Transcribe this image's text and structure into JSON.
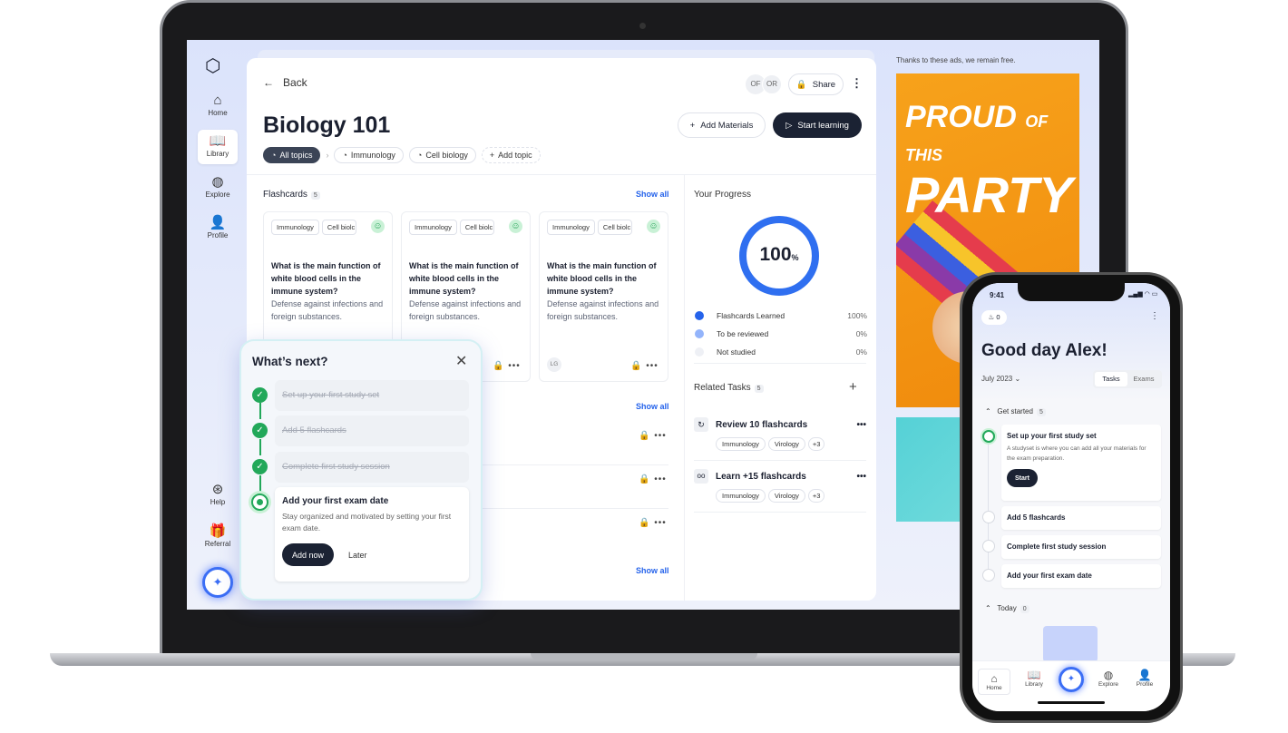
{
  "sidebar": {
    "items": [
      {
        "label": "Home",
        "icon": "home-icon"
      },
      {
        "label": "Library",
        "icon": "book-icon"
      },
      {
        "label": "Explore",
        "icon": "globe-icon"
      },
      {
        "label": "Profile",
        "icon": "user-icon"
      },
      {
        "label": "Help",
        "icon": "lifebuoy-icon"
      },
      {
        "label": "Referral",
        "icon": "gift-hand-icon"
      }
    ],
    "active": "Library"
  },
  "header": {
    "back": "Back",
    "avatars": [
      "OF",
      "OR"
    ],
    "share": "Share",
    "title": "Biology 101",
    "add_materials": "Add Materials",
    "start_learning": "Start learning"
  },
  "topics": [
    "All topics",
    "Immunology",
    "Cell biology",
    "Add topic"
  ],
  "flashcards": {
    "title": "Flashcards",
    "count": "5",
    "show_all": "Show all",
    "cards": [
      {
        "tags": [
          "Immunology",
          "Cell biolc"
        ],
        "question": "What is the main function of white blood cells in the immune system?",
        "answer": "Defense against infections and foreign substances."
      },
      {
        "tags": [
          "Immunology",
          "Cell biolc"
        ],
        "question": "What is the main function of white blood cells in the immune system?",
        "answer": "Defense against infections and foreign substances."
      },
      {
        "tags": [
          "Immunology",
          "Cell biolc"
        ],
        "question": "What is the main function of white blood cells in the immune system?",
        "answer": "Defense against infections and foreign substances.",
        "avatar": "LG"
      }
    ]
  },
  "section2": {
    "show_all": "Show all"
  },
  "section3": {
    "show_all": "Show all"
  },
  "progress": {
    "title": "Your Progress",
    "value": "100",
    "unit": "%",
    "percent": 100,
    "legend": [
      {
        "label": "Flashcards Learned",
        "value": "100%",
        "color": "#2563eb"
      },
      {
        "label": "To be reviewed",
        "value": "0%",
        "color": "#93b4fb"
      },
      {
        "label": "Not studied",
        "value": "0%",
        "color": "#eef0f5"
      }
    ]
  },
  "related": {
    "title": "Related Tasks",
    "count": "5",
    "tasks": [
      {
        "title": "Review 10 flashcards",
        "tags": [
          "Immunology",
          "Virology",
          "+3"
        ]
      },
      {
        "title": "Learn +15 flashcards",
        "tags": [
          "Immunology",
          "Virology",
          "+3"
        ]
      }
    ]
  },
  "popup": {
    "title": "What’s next?",
    "steps": [
      "Set up your first study set",
      "Add 5 flashcards",
      "Complete first study session"
    ],
    "current": {
      "title": "Add your first exam date",
      "desc": "Stay organized and motivated by setting your first exam date.",
      "primary": "Add now",
      "secondary": "Later"
    }
  },
  "ad": {
    "note": "Thanks to these ads, we remain free.",
    "headline_a": "PROUD",
    "headline_b": "OF THIS",
    "headline_c": "PARTY"
  },
  "phone": {
    "time": "9:41",
    "streak": "0",
    "greeting": "Good day Alex!",
    "month": "July 2023",
    "tabs": [
      "Tasks",
      "Exams"
    ],
    "get_started": "Get started",
    "get_started_count": "5",
    "tasks": [
      {
        "title": "Set up your first study set",
        "desc": "A studyset is where you can add all your materials for the exam preparation.",
        "button": "Start"
      },
      {
        "title": "Add 5 flashcards"
      },
      {
        "title": "Complete first study session"
      },
      {
        "title": "Add your first exam date"
      }
    ],
    "today": "Today",
    "today_count": "0",
    "nav": [
      "Home",
      "Library",
      "Explore",
      "Profile"
    ]
  }
}
